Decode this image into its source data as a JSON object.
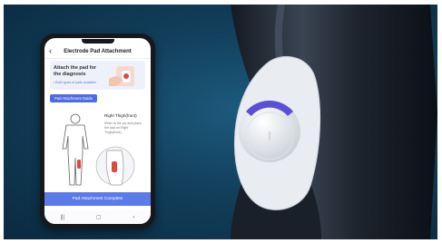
{
  "app": {
    "title": "Electrode Pad Attachment",
    "back_icon": "chevron-left-icon"
  },
  "banner": {
    "title": "Attach the pad for the diagnosis",
    "note": "• Both types of pads available"
  },
  "guide": {
    "button_label": "Pad Attachment Guide",
    "step_label": "Right Thigh(front)",
    "step_desc": "Refer to the pic and place the pad on Right Thigh(front)."
  },
  "footer": {
    "complete_label": "Pad Attachment Complete"
  },
  "nav": {
    "recents_icon": "recents-icon",
    "home_icon": "home-icon",
    "back_icon": "back-icon",
    "recents_glyph": "|||",
    "home_glyph": "▢",
    "back_glyph": "‹"
  },
  "colors": {
    "accent": "#5c7ae8",
    "background": "#123f5b",
    "pad_ring": "#5b4fd6"
  }
}
